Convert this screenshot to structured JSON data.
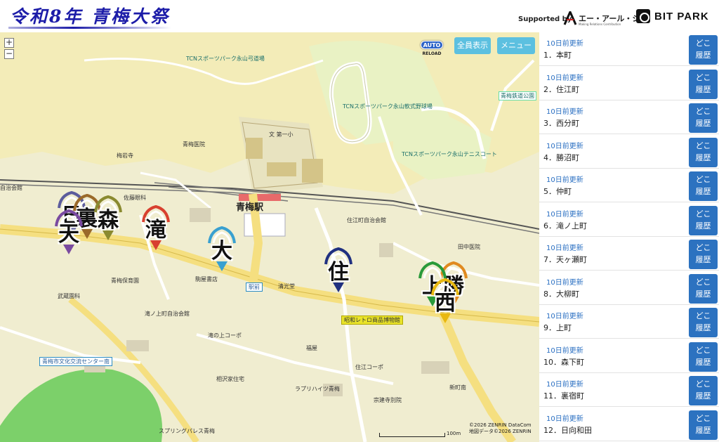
{
  "header": {
    "title": "令和8年 青梅大祭",
    "supported_by": "Supported by",
    "sponsor1": {
      "name": "エー・アール・シー",
      "tagline": "Making Relations Contribution"
    },
    "sponsor2": {
      "name": "BIT PARK"
    }
  },
  "map": {
    "zoom_in": "+",
    "zoom_out": "−",
    "auto_label": "AUTO",
    "reload_label": "RELOAD",
    "show_all": "全員表示",
    "menu": "メニュー",
    "copyright_line1": "©2026 ZENRIN DataCom",
    "copyright_line2": "地図データ©2026 ZENRIN",
    "scale": "100m",
    "labels": {
      "archery": "TCNスポーツパーク永山弓道場",
      "baseball": "TCNスポーツパーク永山軟式野球場",
      "tennis": "TCNスポーツパーク永山テニスコート",
      "railpark": "青梅鉄道公園",
      "school": "文 第一小",
      "hospital": "青梅医院",
      "baigan": "梅岩寺",
      "sakura": "佐藤眼科",
      "station": "青梅駅",
      "jichikai": "住江町自治会館",
      "kiyomizu": "清光堂",
      "ekimae": "駅前",
      "komaya": "駒屋書店",
      "museum": "昭和レトロ商品博物館",
      "bunka": "青梅市文化交流センター南",
      "mushoen": "武蔵園科",
      "jichikai2": "滝ノ上町自治会館",
      "taki": "滝の上コーポ",
      "fuku": "福屋",
      "sumie": "住江コーポ",
      "nakajuku": "相沢家住宅",
      "rapuri": "ラプリハイツ青梅",
      "sokenji": "宗建寺別院",
      "spring": "スプリングパレス青梅",
      "tanakaiin": "田中医院",
      "shinmachi": "新町南",
      "hoikuen": "青梅保育園",
      "jichikan3": "自治会館"
    }
  },
  "floats": [
    {
      "kanji": "日",
      "color": "#5c5c9c"
    },
    {
      "kanji": "裏",
      "color": "#9a6a2a"
    },
    {
      "kanji": "森",
      "color": "#8a8a30"
    },
    {
      "kanji": "天",
      "color": "#7a4aa0"
    },
    {
      "kanji": "滝",
      "color": "#d84030"
    },
    {
      "kanji": "大",
      "color": "#39a0d0"
    },
    {
      "kanji": "住",
      "color": "#203080"
    },
    {
      "kanji": "勝",
      "color": "#e08a20"
    },
    {
      "kanji": "上",
      "color": "#2a9a3a"
    },
    {
      "kanji": "西",
      "color": "#e8b810"
    }
  ],
  "sidebar": {
    "items": [
      {
        "time": "10日前更新",
        "name": "1．本町",
        "btn": "どこ履歴"
      },
      {
        "time": "10日前更新",
        "name": "2．住江町",
        "btn": "どこ履歴"
      },
      {
        "time": "10日前更新",
        "name": "3．西分町",
        "btn": "どこ履歴"
      },
      {
        "time": "10日前更新",
        "name": "4．勝沼町",
        "btn": "どこ履歴"
      },
      {
        "time": "10日前更新",
        "name": "5．仲町",
        "btn": "どこ履歴"
      },
      {
        "time": "10日前更新",
        "name": "6．滝ノ上町",
        "btn": "どこ履歴"
      },
      {
        "time": "10日前更新",
        "name": "7．天ヶ瀬町",
        "btn": "どこ履歴"
      },
      {
        "time": "10日前更新",
        "name": "8．大柳町",
        "btn": "どこ履歴"
      },
      {
        "time": "10日前更新",
        "name": "9．上町",
        "btn": "どこ履歴"
      },
      {
        "time": "10日前更新",
        "name": "10．森下町",
        "btn": "どこ履歴"
      },
      {
        "time": "10日前更新",
        "name": "11．裏宿町",
        "btn": "どこ履歴"
      },
      {
        "time": "10日前更新",
        "name": "12．日向和田",
        "btn": "どこ履歴"
      }
    ]
  },
  "colors": {
    "accent": "#2c72c0",
    "map_button": "#5cc0e0",
    "title": "#1c1ca8"
  }
}
